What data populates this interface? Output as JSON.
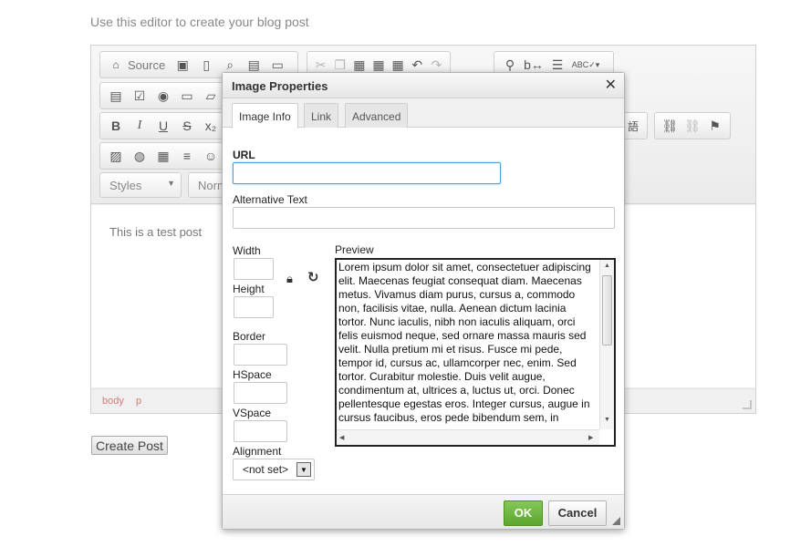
{
  "page": {
    "intro": "Use this editor to create your blog post",
    "create_post_label": "Create Post"
  },
  "editor": {
    "source_label": "Source",
    "styles_combo": "Styles",
    "format_combo": "Norm",
    "content_text": "This is a test post",
    "path": [
      "body",
      "p"
    ],
    "icons_row1": [
      "source-icon",
      "save-icon",
      "new-page-icon",
      "preview-icon",
      "print-icon",
      "templates-icon",
      "cut-icon",
      "copy-icon",
      "paste-icon",
      "paste-text-icon",
      "paste-word-icon",
      "undo-icon",
      "redo-icon",
      "find-icon",
      "replace-icon",
      "select-all-icon",
      "spellcheck-icon"
    ],
    "icons_row2": [
      "form-icon",
      "checkbox-icon",
      "radio-icon",
      "textfield-icon",
      "textarea-icon"
    ],
    "icons_row3": [
      "bold-icon",
      "italic-icon",
      "underline-icon",
      "strike-icon",
      "subscript-icon",
      "language-icon",
      "link-icon",
      "unlink-icon",
      "anchor-icon"
    ],
    "icons_row4": [
      "image-icon",
      "flash-icon",
      "table-icon",
      "horizontal-rule-icon",
      "smiley-icon"
    ],
    "language_glyph": "語"
  },
  "dialog": {
    "title": "Image Properties",
    "close_glyph": "✕",
    "tabs": [
      {
        "label": "Image Info",
        "active": true
      },
      {
        "label": "Link",
        "active": false
      },
      {
        "label": "Advanced",
        "active": false
      }
    ],
    "url_label": "URL",
    "url_value": "",
    "alt_label": "Alternative Text",
    "alt_value": "",
    "width_label": "Width",
    "height_label": "Height",
    "border_label": "Border",
    "hspace_label": "HSpace",
    "vspace_label": "VSpace",
    "alignment_label": "Alignment",
    "alignment_value": "<not set>",
    "preview_label": "Preview",
    "preview_text": "Lorem ipsum dolor sit amet, consectetuer adipiscing elit. Maecenas feugiat consequat diam. Maecenas metus. Vivamus diam purus, cursus a, commodo non, facilisis vitae, nulla. Aenean dictum lacinia tortor. Nunc iaculis, nibh non iaculis aliquam, orci felis euismod neque, sed ornare massa mauris sed velit. Nulla pretium mi et risus. Fusce mi pede, tempor id, cursus ac, ullamcorper nec, enim. Sed tortor. Curabitur molestie. Duis velit augue, condimentum at, ultrices a, luctus ut, orci. Donec pellentesque egestas eros. Integer cursus, augue in cursus faucibus, eros pede bibendum sem, in tempus tellus justo quis ligula. Etiam eget",
    "ok_label": "OK",
    "cancel_label": "Cancel",
    "accent_ok": "#5aa82c"
  }
}
